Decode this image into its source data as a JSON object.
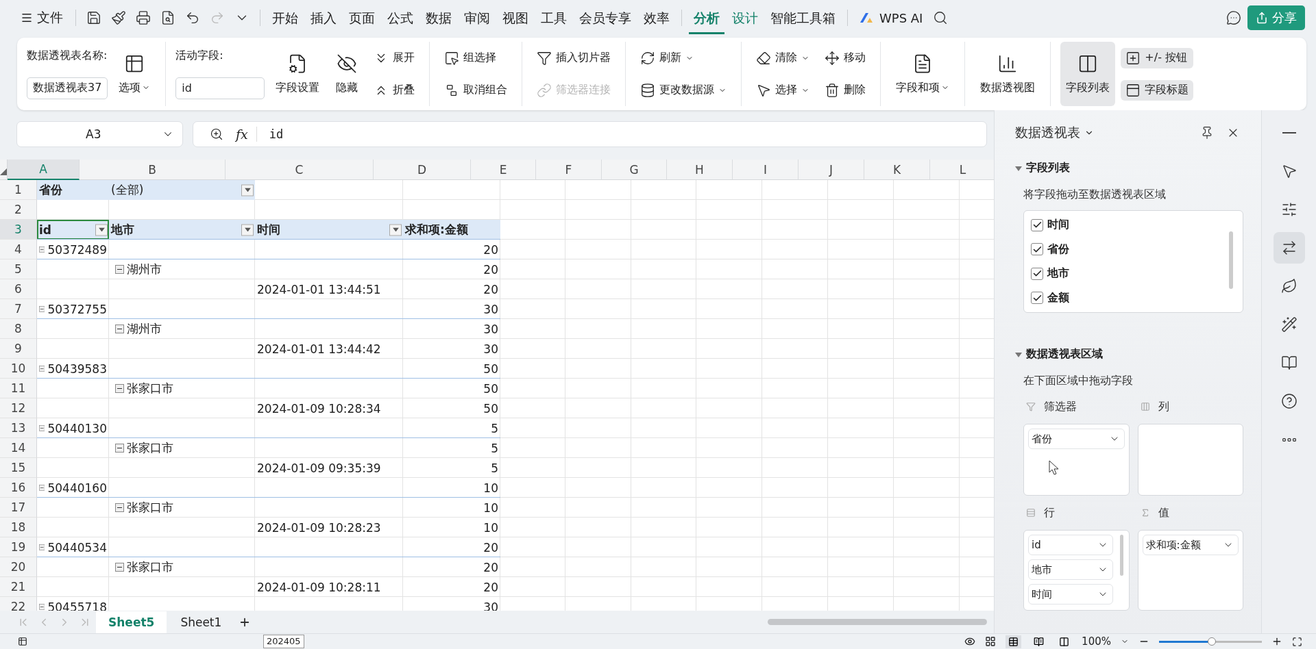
{
  "menu": {
    "file": "文件",
    "tabs": [
      {
        "label": "开始",
        "selected": false,
        "contextual": false
      },
      {
        "label": "插入",
        "selected": false,
        "contextual": false
      },
      {
        "label": "页面",
        "selected": false,
        "contextual": false
      },
      {
        "label": "公式",
        "selected": false,
        "contextual": false
      },
      {
        "label": "数据",
        "selected": false,
        "contextual": false
      },
      {
        "label": "审阅",
        "selected": false,
        "contextual": false
      },
      {
        "label": "视图",
        "selected": false,
        "contextual": false
      },
      {
        "label": "工具",
        "selected": false,
        "contextual": false
      },
      {
        "label": "会员专享",
        "selected": false,
        "contextual": false
      },
      {
        "label": "效率",
        "selected": false,
        "contextual": false
      },
      {
        "label": "分析",
        "selected": true,
        "contextual": true
      },
      {
        "label": "设计",
        "selected": false,
        "contextual": true
      },
      {
        "label": "智能工具箱",
        "selected": false,
        "contextual": false
      }
    ],
    "ai": "WPS AI",
    "share": "分享"
  },
  "ribbon": [
    {
      "columns": [
        [
          {
            "kind": "field",
            "label": "数据透视表名称:",
            "value": "数据透视表37"
          }
        ],
        [
          {
            "kind": "large",
            "label": "选项",
            "dropdown": true,
            "disabled": false,
            "pressed": false
          }
        ]
      ]
    },
    {
      "columns": [
        [
          {
            "kind": "field",
            "label": "活动字段:",
            "value": "id"
          }
        ],
        [
          {
            "kind": "large",
            "label": "字段设置",
            "dropdown": false,
            "disabled": false,
            "pressed": false
          }
        ],
        [
          {
            "kind": "large",
            "label": "隐藏",
            "dropdown": false,
            "disabled": false,
            "pressed": false
          }
        ],
        [
          {
            "kind": "small",
            "label": "展开",
            "dropdown": false,
            "disabled": false,
            "pressed": false
          },
          {
            "kind": "small",
            "label": "折叠",
            "dropdown": false,
            "disabled": false,
            "pressed": false
          }
        ]
      ]
    },
    {
      "columns": [
        [
          {
            "kind": "small",
            "label": "组选择",
            "dropdown": false,
            "disabled": false,
            "pressed": false
          },
          {
            "kind": "small",
            "label": "取消组合",
            "dropdown": false,
            "disabled": false,
            "pressed": false
          }
        ]
      ]
    },
    {
      "columns": [
        [
          {
            "kind": "small",
            "label": "插入切片器",
            "dropdown": false,
            "disabled": false,
            "pressed": false
          },
          {
            "kind": "small",
            "label": "筛选器连接",
            "dropdown": false,
            "disabled": true,
            "pressed": false
          }
        ]
      ]
    },
    {
      "columns": [
        [
          {
            "kind": "small",
            "label": "刷新",
            "dropdown": true,
            "disabled": false,
            "pressed": false
          },
          {
            "kind": "small",
            "label": "更改数据源",
            "dropdown": true,
            "disabled": false,
            "pressed": false
          }
        ]
      ]
    },
    {
      "columns": [
        [
          {
            "kind": "small",
            "label": "清除",
            "dropdown": true,
            "disabled": false,
            "pressed": false
          },
          {
            "kind": "small",
            "label": "选择",
            "dropdown": true,
            "disabled": false,
            "pressed": false
          }
        ],
        [
          {
            "kind": "small",
            "label": "移动",
            "dropdown": false,
            "disabled": false,
            "pressed": false
          },
          {
            "kind": "small",
            "label": "删除",
            "dropdown": false,
            "disabled": false,
            "pressed": false
          }
        ]
      ]
    },
    {
      "columns": [
        [
          {
            "kind": "large",
            "label": "字段和项",
            "dropdown": true,
            "disabled": false,
            "pressed": false
          }
        ]
      ]
    },
    {
      "columns": [
        [
          {
            "kind": "large",
            "label": "数据透视图",
            "dropdown": false,
            "disabled": false,
            "pressed": false
          }
        ]
      ]
    },
    {
      "columns": [
        [
          {
            "kind": "large",
            "label": "字段列表",
            "dropdown": false,
            "disabled": false,
            "pressed": true
          }
        ],
        [
          {
            "kind": "small",
            "label": "+/- 按钮",
            "dropdown": false,
            "disabled": false,
            "pressed": true
          },
          {
            "kind": "small",
            "label": "字段标题",
            "dropdown": false,
            "disabled": false,
            "pressed": true
          }
        ]
      ]
    }
  ],
  "formula": {
    "name_box": "A3",
    "fx": "fx",
    "value": "id"
  },
  "sheet": {
    "columns": [
      {
        "label": "A",
        "selected": true
      },
      {
        "label": "B",
        "selected": false
      },
      {
        "label": "C",
        "selected": false
      },
      {
        "label": "D",
        "selected": false
      },
      {
        "label": "E",
        "selected": false
      },
      {
        "label": "F",
        "selected": false
      },
      {
        "label": "G",
        "selected": false
      },
      {
        "label": "H",
        "selected": false
      },
      {
        "label": "I",
        "selected": false
      },
      {
        "label": "J",
        "selected": false
      },
      {
        "label": "K",
        "selected": false
      },
      {
        "label": "L",
        "selected": false
      }
    ],
    "rows": [
      {
        "number": "1",
        "selected": false,
        "kind": "filter",
        "label": "省份",
        "value": "(全部)"
      },
      {
        "number": "2",
        "selected": false,
        "kind": "blank"
      },
      {
        "number": "3",
        "selected": true,
        "kind": "header",
        "cells": [
          "id",
          "地市",
          "时间",
          "求和项:金额"
        ]
      },
      {
        "number": "4",
        "selected": false,
        "kind": "id",
        "label": "50372489",
        "sum": "20"
      },
      {
        "number": "5",
        "selected": false,
        "kind": "city",
        "label": "湖州市",
        "sum": "20"
      },
      {
        "number": "6",
        "selected": false,
        "kind": "time",
        "label": "2024-01-01 13:44:51",
        "sum": "20"
      },
      {
        "number": "7",
        "selected": false,
        "kind": "id",
        "label": "50372755",
        "sum": "30"
      },
      {
        "number": "8",
        "selected": false,
        "kind": "city",
        "label": "湖州市",
        "sum": "30"
      },
      {
        "number": "9",
        "selected": false,
        "kind": "time",
        "label": "2024-01-01 13:44:42",
        "sum": "30"
      },
      {
        "number": "10",
        "selected": false,
        "kind": "id",
        "label": "50439583",
        "sum": "50"
      },
      {
        "number": "11",
        "selected": false,
        "kind": "city",
        "label": "张家口市",
        "sum": "50"
      },
      {
        "number": "12",
        "selected": false,
        "kind": "time",
        "label": "2024-01-09 10:28:34",
        "sum": "50"
      },
      {
        "number": "13",
        "selected": false,
        "kind": "id",
        "label": "50440130",
        "sum": "5"
      },
      {
        "number": "14",
        "selected": false,
        "kind": "city",
        "label": "张家口市",
        "sum": "5"
      },
      {
        "number": "15",
        "selected": false,
        "kind": "time",
        "label": "2024-01-09 09:35:39",
        "sum": "5"
      },
      {
        "number": "16",
        "selected": false,
        "kind": "id",
        "label": "50440160",
        "sum": "10"
      },
      {
        "number": "17",
        "selected": false,
        "kind": "city",
        "label": "张家口市",
        "sum": "10"
      },
      {
        "number": "18",
        "selected": false,
        "kind": "time",
        "label": "2024-01-09 10:28:23",
        "sum": "10"
      },
      {
        "number": "19",
        "selected": false,
        "kind": "id",
        "label": "50440534",
        "sum": "20"
      },
      {
        "number": "20",
        "selected": false,
        "kind": "city",
        "label": "张家口市",
        "sum": "20"
      },
      {
        "number": "21",
        "selected": false,
        "kind": "time",
        "label": "2024-01-09 10:28:11",
        "sum": "20"
      },
      {
        "number": "22",
        "selected": false,
        "kind": "id",
        "label": "50455718",
        "sum": "30"
      }
    ]
  },
  "sheet_tabs": [
    {
      "label": "Sheet5",
      "selected": true
    },
    {
      "label": "Sheet1",
      "selected": false
    }
  ],
  "status": {
    "field": "202405",
    "views": [
      {
        "selected": true
      },
      {
        "selected": false
      },
      {
        "selected": false
      }
    ],
    "zoom": "100%",
    "zoom_slider": {
      "level": 0.51
    }
  },
  "panel": {
    "title": "数据透视表",
    "field_section": {
      "title": "字段列表",
      "expanded": true,
      "hint": "将字段拖动至数据透视表区域",
      "fields": [
        {
          "label": "时间",
          "checked": true
        },
        {
          "label": "省份",
          "checked": true
        },
        {
          "label": "地市",
          "checked": true
        },
        {
          "label": "金额",
          "checked": true
        }
      ]
    },
    "area_section": {
      "title": "数据透视表区域",
      "expanded": true,
      "hint": "在下面区域中拖动字段",
      "areas": [
        {
          "kind": "filter",
          "label": "筛选器",
          "items": [
            "省份"
          ]
        },
        {
          "kind": "columns",
          "label": "列"
        },
        {
          "kind": "rows",
          "label": "行",
          "items": [
            "id",
            "地市",
            "时间"
          ]
        },
        {
          "kind": "values",
          "label": "值",
          "items": [
            "求和项:金额"
          ]
        }
      ]
    }
  },
  "rail": [
    {
      "selected": false
    },
    {
      "selected": false
    },
    {
      "selected": false
    },
    {
      "selected": true
    },
    {
      "selected": false
    },
    {
      "selected": false
    },
    {
      "selected": false
    },
    {
      "selected": false
    },
    {
      "selected": false
    }
  ]
}
